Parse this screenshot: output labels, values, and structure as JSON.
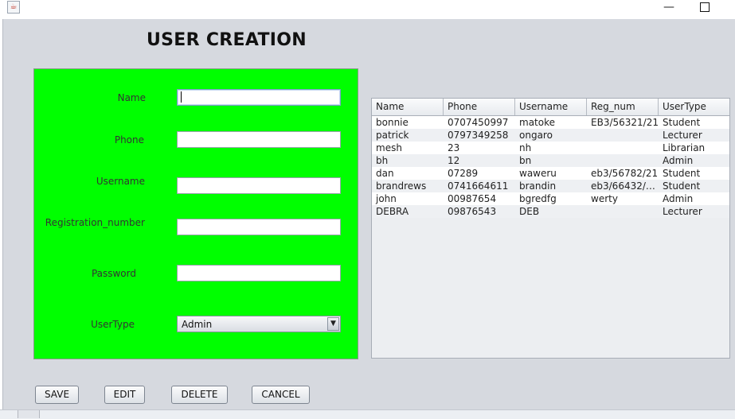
{
  "window": {
    "icon": "java-app-icon"
  },
  "page_title": "USER CREATION",
  "form": {
    "name_label": "Name",
    "name_value": "",
    "phone_label": "Phone",
    "phone_value": "",
    "username_label": "Username",
    "username_value": "",
    "regnum_label": "Registration_number",
    "regnum_value": "",
    "password_label": "Password",
    "password_value": "",
    "usertype_label": "UserType",
    "usertype_value": "Admin",
    "panel_color": "#00ff00"
  },
  "table": {
    "columns": [
      "Name",
      "Phone",
      "Username",
      "Reg_num",
      "UserType"
    ],
    "rows": [
      [
        "bonnie",
        "0707450997",
        "matoke",
        "EB3/56321/21",
        "Student"
      ],
      [
        "patrick",
        "0797349258",
        "ongaro",
        "",
        "Lecturer"
      ],
      [
        "mesh",
        "23",
        "nh",
        "",
        "Librarian"
      ],
      [
        "bh",
        "12",
        "bn",
        "",
        "Admin"
      ],
      [
        "dan",
        "07289",
        "waweru",
        "eb3/56782/21",
        "Student"
      ],
      [
        "brandrews",
        "0741664611",
        "brandin",
        "eb3/66432/2...",
        "Student"
      ],
      [
        "john",
        "00987654",
        "bgredfg",
        "werty",
        "Admin"
      ],
      [
        "DEBRA",
        "09876543",
        "DEB",
        "",
        "Lecturer"
      ]
    ]
  },
  "buttons": {
    "save": "SAVE",
    "edit": "EDIT",
    "delete": "DELETE",
    "cancel": "CANCEL"
  }
}
